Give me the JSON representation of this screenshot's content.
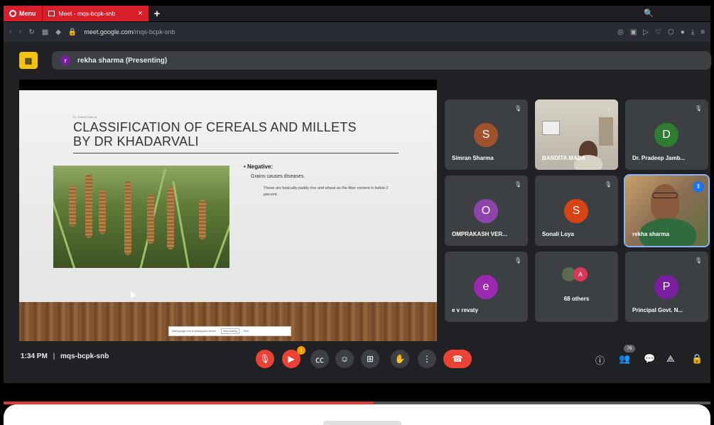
{
  "browser": {
    "menu_label": "Menu",
    "tab_title": "Meet - mqs-bcpk-snb",
    "tab_close": "×",
    "new_tab": "+",
    "search_glyph": "🔍",
    "url_host": "meet.google.com",
    "url_path": "/mqs-bcpk-snb"
  },
  "presenting": {
    "avatar_letter": "r",
    "label": "rekha sharma (Presenting)"
  },
  "slide": {
    "author": "Dr. Vratha Sharma",
    "title": "CLASSIFICATION OF CEREALS AND MILLETS BY DR KHADARVALI",
    "bullet1": "• Negative:",
    "bullet2": "Grains causes diseases.",
    "bullet3": "These are basically paddy rice and wheat as the fiber content is below 2 percent.",
    "toast_text": "Meet.google.com is sharing your screen.",
    "toast_stop": "Stop sharing",
    "toast_hide": "Hide"
  },
  "participants": [
    {
      "name": "Simran Sharma",
      "letter": "S",
      "color": "#a0522d"
    },
    {
      "name": "BANDITA MADA",
      "letter": "",
      "color": ""
    },
    {
      "name": "Dr. Pradeep Jamb...",
      "letter": "D",
      "color": "#2e7d32"
    },
    {
      "name": "OMPRAKASH VER...",
      "letter": "O",
      "color": "#8e44ad"
    },
    {
      "name": "Sonali Loya",
      "letter": "S",
      "color": "#d84315"
    },
    {
      "name": "rekha sharma",
      "letter": "",
      "color": ""
    },
    {
      "name": "e v revaty",
      "letter": "e",
      "color": "#9c27b0"
    },
    {
      "name": "68 others",
      "letter": "A",
      "color": "#d93858"
    },
    {
      "name": "Principal Govt. N...",
      "letter": "P",
      "color": "#7b1fa2"
    }
  ],
  "controls": {
    "time": "1:34 PM",
    "separator": "|",
    "meeting_code": "mqs-bcpk-snb",
    "chat_badge": "1",
    "people_count": "76"
  }
}
